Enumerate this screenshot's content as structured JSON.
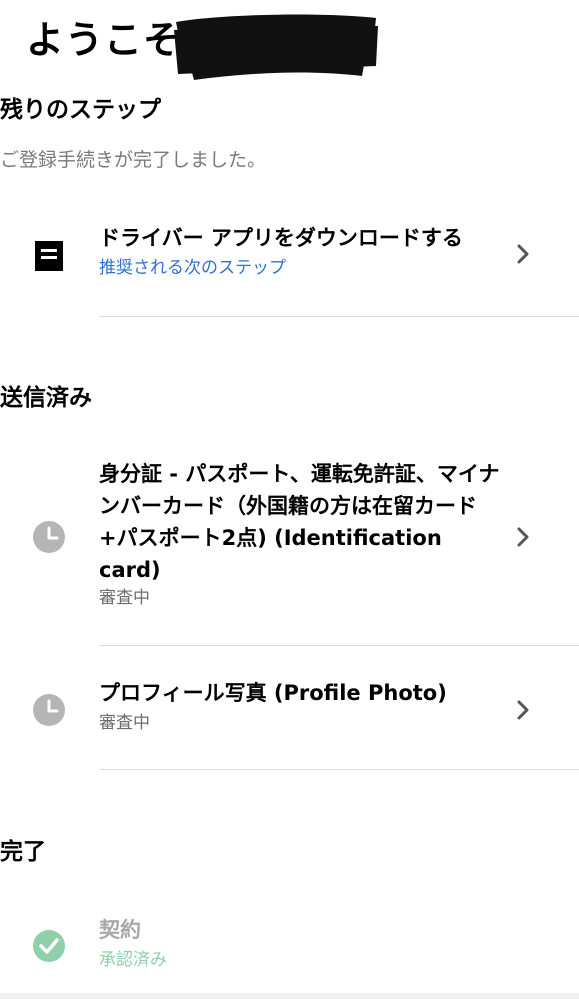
{
  "header": {
    "greeting": "ようこそ、"
  },
  "remaining": {
    "title": "残りのステップ",
    "subtitle": "ご登録手続きが完了しました。",
    "items": [
      {
        "title": "ドライバー アプリをダウンロードする",
        "status": "推奨される次のステップ",
        "icon": "document-icon"
      }
    ]
  },
  "submitted": {
    "title": "送信済み",
    "items": [
      {
        "title": "身分証 - パスポート、運転免許証、マイナンバーカード（外国籍の方は在留カード+パスポート2点) (Identification card)",
        "status": "審査中",
        "icon": "clock-icon"
      },
      {
        "title": "プロフィール写真 (Profile Photo)",
        "status": "審査中",
        "icon": "clock-icon"
      }
    ]
  },
  "completed": {
    "title": "完了",
    "items": [
      {
        "title": "契約",
        "status": "承認済み",
        "icon": "check-circle-icon"
      }
    ]
  },
  "colors": {
    "link_blue": "#2f6fd6",
    "status_gray": "#6e6e6e",
    "approved_green": "#8fcfaa",
    "clock_gray": "#b5b5b5"
  }
}
